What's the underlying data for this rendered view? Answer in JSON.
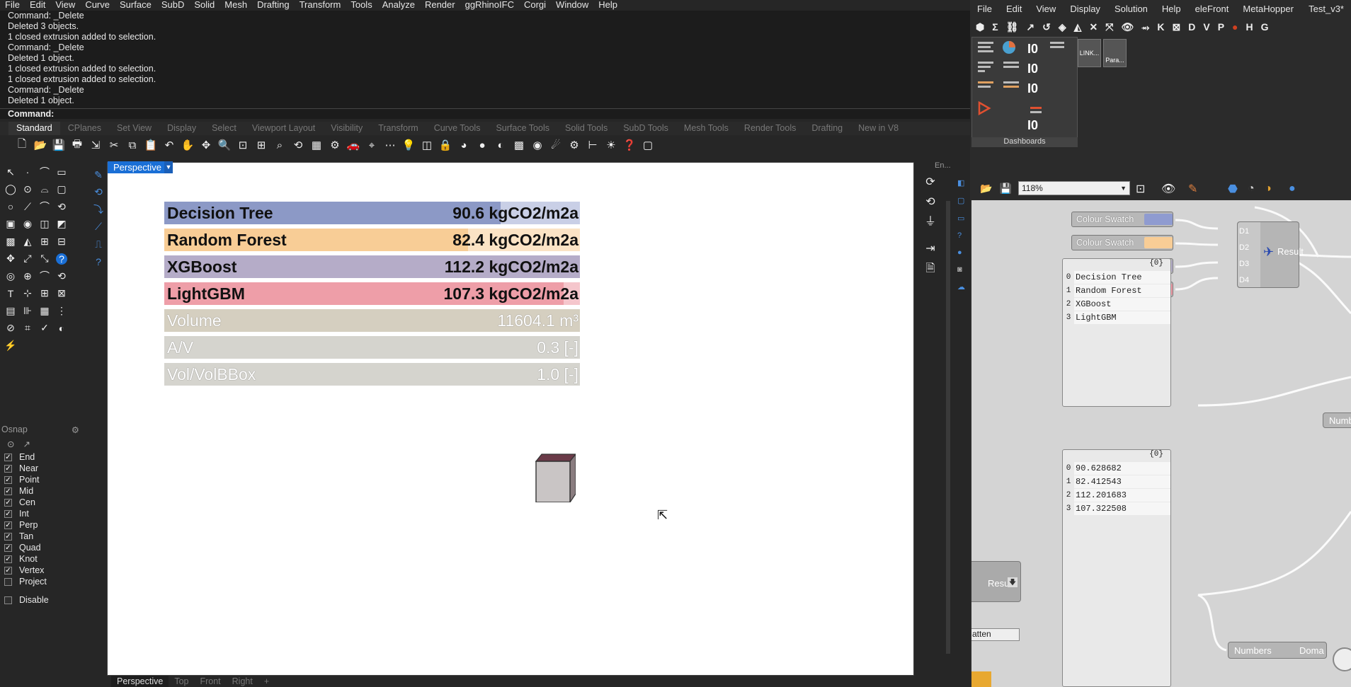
{
  "rhino": {
    "menu": [
      "File",
      "Edit",
      "View",
      "Curve",
      "Surface",
      "SubD",
      "Solid",
      "Mesh",
      "Drafting",
      "Transform",
      "Tools",
      "Analyze",
      "Render",
      "ggRhinoIFC",
      "Corgi",
      "Window",
      "Help"
    ],
    "command_history": [
      "Command: _Delete",
      "Deleted 3 objects.",
      "1 closed extrusion added to selection.",
      "Command: _Delete",
      "Deleted 1 object.",
      "1 closed extrusion added to selection.",
      "1 closed extrusion added to selection.",
      "Command: _Delete",
      "Deleted 1 object."
    ],
    "command_prompt": "Command:",
    "toolbar_tabs": [
      "Standard",
      "CPlanes",
      "Set View",
      "Display",
      "Select",
      "Viewport Layout",
      "Visibility",
      "Transform",
      "Curve Tools",
      "Surface Tools",
      "Solid Tools",
      "SubD Tools",
      "Mesh Tools",
      "Render Tools",
      "Drafting",
      "New in V8"
    ],
    "active_tab": "Standard",
    "viewport_title": "Perspective",
    "viewport_tabs": [
      "Perspective",
      "Top",
      "Front",
      "Right",
      "+"
    ],
    "right_panel_label": "En...",
    "osnap": {
      "title": "Osnap",
      "items": [
        {
          "label": "End",
          "checked": true
        },
        {
          "label": "Near",
          "checked": true
        },
        {
          "label": "Point",
          "checked": true
        },
        {
          "label": "Mid",
          "checked": true
        },
        {
          "label": "Cen",
          "checked": true
        },
        {
          "label": "Int",
          "checked": true
        },
        {
          "label": "Perp",
          "checked": true
        },
        {
          "label": "Tan",
          "checked": true
        },
        {
          "label": "Quad",
          "checked": true
        },
        {
          "label": "Knot",
          "checked": true
        },
        {
          "label": "Vertex",
          "checked": true
        },
        {
          "label": "Project",
          "checked": false
        }
      ],
      "disable_label": "Disable"
    },
    "predictions": [
      {
        "label": "Decision Tree",
        "value": "90.6 kgCO2/m2a",
        "bg": "#c9cfe6",
        "fill_color": "#8c99c6",
        "fill": 0.81
      },
      {
        "label": "Random Forest",
        "value": "82.4 kgCO2/m2a",
        "bg": "#fbe3c5",
        "fill_color": "#f8cd96",
        "fill": 0.73
      },
      {
        "label": "XGBoost",
        "value": "112.2 kgCO2/m2a",
        "bg": "#d8d4e2",
        "fill_color": "#b5acc8",
        "fill": 1.0
      },
      {
        "label": "LightGBM",
        "value": "107.3 kgCO2/m2a",
        "bg": "#f5c6cc",
        "fill_color": "#ee9ea8",
        "fill": 0.96
      }
    ],
    "metrics": [
      {
        "label": "Volume",
        "value": "11604.1 m³",
        "color": "#d5cfc0"
      },
      {
        "label": "A/V",
        "value": "0.3 [-]",
        "color": "#d5d4ce"
      },
      {
        "label": "Vol/VolBBox",
        "value": "1.0 [-]",
        "color": "#d5d4ce"
      }
    ]
  },
  "gh": {
    "menu": [
      "File",
      "Edit",
      "View",
      "Display",
      "Solution",
      "Help",
      "eleFront",
      "MetaHopper",
      "Test_v3*"
    ],
    "icon_letters": [
      "K",
      "D",
      "V",
      "P",
      "H",
      "G"
    ],
    "dashboards_label": "Dashboards",
    "param_labels": [
      "LINK...",
      "Para..."
    ],
    "zoom": "118%",
    "swatches": [
      {
        "label": "Colour Swatch",
        "color": "#8f9bd0"
      },
      {
        "label": "Colour Swatch",
        "color": "#f8cd96"
      },
      {
        "label": "Colour Swatch",
        "color": "#b7b0cc"
      },
      {
        "label": "Colour Swatch",
        "color": "#f19aa6"
      }
    ],
    "result_node": {
      "inputs": [
        "D1",
        "D2",
        "D3",
        "D4"
      ],
      "label": "Result"
    },
    "panel_names": {
      "header": "{0}",
      "rows": [
        {
          "i": "0",
          "v": "Decision Tree"
        },
        {
          "i": "1",
          "v": "Random Forest"
        },
        {
          "i": "2",
          "v": "XGBoost"
        },
        {
          "i": "3",
          "v": "LightGBM"
        }
      ]
    },
    "panel_values": {
      "header": "{0}",
      "rows": [
        {
          "i": "0",
          "v": "90.628682"
        },
        {
          "i": "1",
          "v": "82.412543"
        },
        {
          "i": "2",
          "v": "112.201683"
        },
        {
          "i": "3",
          "v": "107.322508"
        }
      ]
    },
    "result2_label": "Result",
    "flatten_label": "atten",
    "numbers_label": "Numbers",
    "domain_label": "Doma",
    "numbe_label": "Numbe"
  }
}
